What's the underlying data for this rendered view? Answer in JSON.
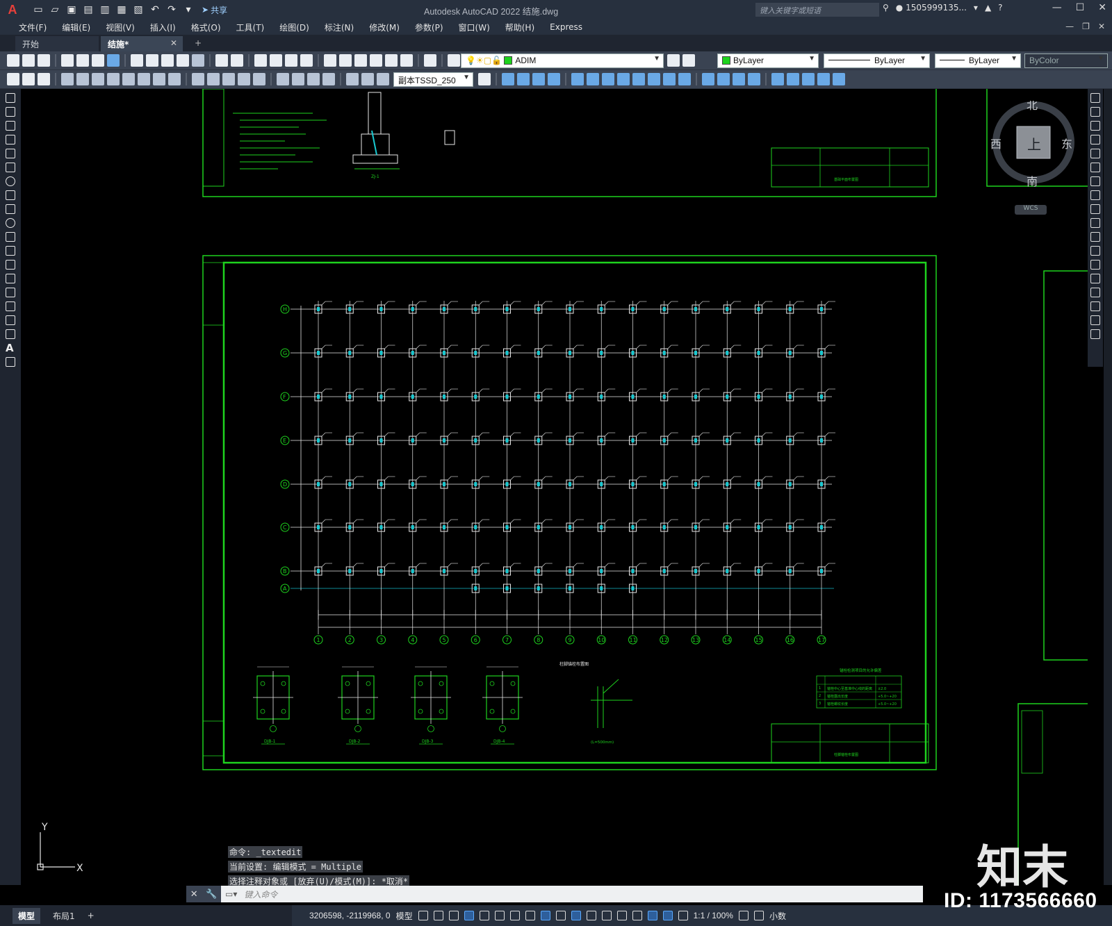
{
  "app": {
    "title": "Autodesk AutoCAD 2022    结施.dwg",
    "share_label": "共享",
    "search_placeholder": "键入关键字或短语",
    "user": "1505999135...",
    "logo_letter": "A"
  },
  "menu": {
    "items": [
      "文件(F)",
      "编辑(E)",
      "视图(V)",
      "插入(I)",
      "格式(O)",
      "工具(T)",
      "绘图(D)",
      "标注(N)",
      "修改(M)",
      "参数(P)",
      "窗口(W)",
      "帮助(H)",
      "Express"
    ]
  },
  "tabs": {
    "start": "开始",
    "active": "结施*",
    "close": "✕",
    "add": "+"
  },
  "toolbar": {
    "layer_name": "ADIM",
    "color": "ByLayer",
    "linetype": "ByLayer",
    "lineweight": "ByLayer",
    "plotstyle": "ByColor",
    "dimstyle": "副本TSSD_250"
  },
  "viewcube": {
    "north": "北",
    "south": "南",
    "east": "东",
    "west": "西",
    "face": "上",
    "wcs": "WCS"
  },
  "drawing": {
    "row_axes": [
      "H",
      "G",
      "F",
      "E",
      "D",
      "C",
      "B",
      "A"
    ],
    "col_axes": [
      "1",
      "2",
      "3",
      "4",
      "5",
      "6",
      "7",
      "8",
      "9",
      "10",
      "11",
      "12",
      "13",
      "14",
      "15",
      "16",
      "17"
    ],
    "detail_labels": [
      "DJB-1",
      "DJB-2",
      "DJB-3",
      "DJB-4"
    ],
    "detail_title": "柱脚锚栓布置图",
    "detail_note": "(L=500mm)",
    "top_detail_label": "ZJ-1",
    "sheet_title_bottom": "柱脚锚栓布置图",
    "sheet_title_top": "基础平面布置图",
    "table_title": "锚栓检测项目的允许偏差",
    "table_rows": [
      [
        "1",
        "锚栓中心至基准中心线的距离",
        "±2.0"
      ],
      [
        "2",
        "锚栓露出长度",
        "+5.0~+20"
      ],
      [
        "3",
        "锚栓螺纹长度",
        "+5.0~+20"
      ]
    ],
    "colors": {
      "frame": "#1ed31e",
      "grid": "#e8e8e8",
      "cyan": "#19c9d1",
      "axisline": "#17b8c8"
    }
  },
  "command": {
    "history": [
      "命令: _textedit",
      "当前设置: 编辑模式 = Multiple",
      "选择注释对象或 [放弃(U)/模式(M)]: *取消*"
    ],
    "placeholder": "键入命令"
  },
  "layout_tabs": [
    "模型",
    "布局1",
    "+"
  ],
  "status": {
    "coords": "3206598, -2119968, 0",
    "mode": "模型",
    "scale": "1:1 / 100%",
    "units": "小数"
  },
  "ucs": {
    "x": "X",
    "y": "Y"
  },
  "watermark": {
    "id": "ID: 1173566660",
    "brand": "知末"
  }
}
